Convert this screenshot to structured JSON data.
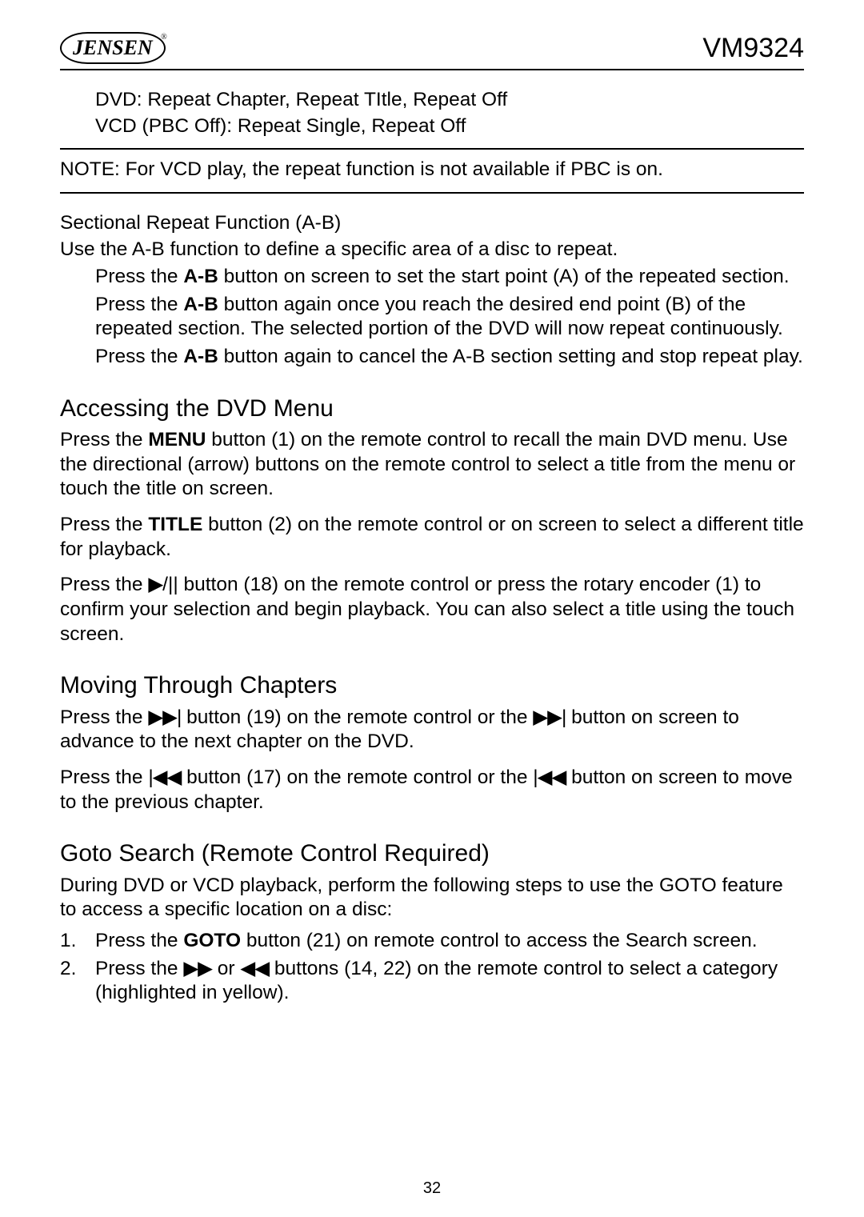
{
  "header": {
    "logo_text": "JENSEN",
    "model": "VM9324"
  },
  "page_number": "32",
  "symbols": {
    "play": "▶",
    "nextTrack": "▶▶|",
    "prevTrack": "|◀◀",
    "ffwd": "▶▶",
    "rew": "◀◀"
  },
  "section_top": {
    "line1": "DVD: Repeat Chapter, Repeat TItle, Repeat Off",
    "line2": "VCD (PBC Off): Repeat Single, Repeat Off"
  },
  "note": "NOTE: For VCD play, the repeat function is not available if PBC is on.",
  "ab": {
    "title": "Sectional Repeat Function (A-B)",
    "intro": "Use the A-B function to define a specific area of a disc to repeat.",
    "step1_a": "Press the ",
    "step1_bold": "A-B",
    "step1_b": " button on screen to set the start point (A) of the repeated section.",
    "step2_a": "Press the ",
    "step2_bold": "A-B",
    "step2_b": " button again once you reach the desired end point (B) of the repeated section. The selected portion of the DVD will now repeat continuously.",
    "step3_a": "Press the ",
    "step3_bold": "A-B",
    "step3_b": " button again to cancel the A-B section setting and stop repeat play."
  },
  "dvd_menu": {
    "heading": "Accessing the DVD Menu",
    "p1_a": "Press the ",
    "p1_bold": "MENU",
    "p1_b": " button (1) on the remote control to recall the main DVD menu. Use the directional (arrow) buttons on the remote control to select a title from the menu or touch the title on screen.",
    "p2_a": "Press the ",
    "p2_bold": "TITLE",
    "p2_b": " button (2) on the remote control or on screen to select a different title for playback.",
    "p3_a": "Press the ",
    "p3_b": "/|| button (18) on the remote control or press the rotary encoder (1) to confirm your selection and begin playback. You can also select a title using the touch screen."
  },
  "chapters": {
    "heading": "Moving Through Chapters",
    "p1_a": "Press the ",
    "p1_b": " button (19) on the remote control or the ",
    "p1_c": " button on screen to advance to the next chapter on the DVD.",
    "p2_a": "Press the ",
    "p2_b": " button (17) on the remote control or the ",
    "p2_c": " button on screen to move to the previous chapter."
  },
  "goto": {
    "heading": "Goto Search (Remote Control Required)",
    "intro": "During DVD or VCD playback, perform the following steps to use the GOTO feature to access a specific location on a disc:",
    "items": [
      {
        "num": "1.",
        "pre": "Press the ",
        "bold": "GOTO",
        "post": " button (21) on remote control to access the  Search screen."
      },
      {
        "num": "2.",
        "pre": "Press the ",
        "mid": " or ",
        "post": " buttons (14, 22) on the remote control to select a category (highlighted in yellow)."
      }
    ]
  }
}
